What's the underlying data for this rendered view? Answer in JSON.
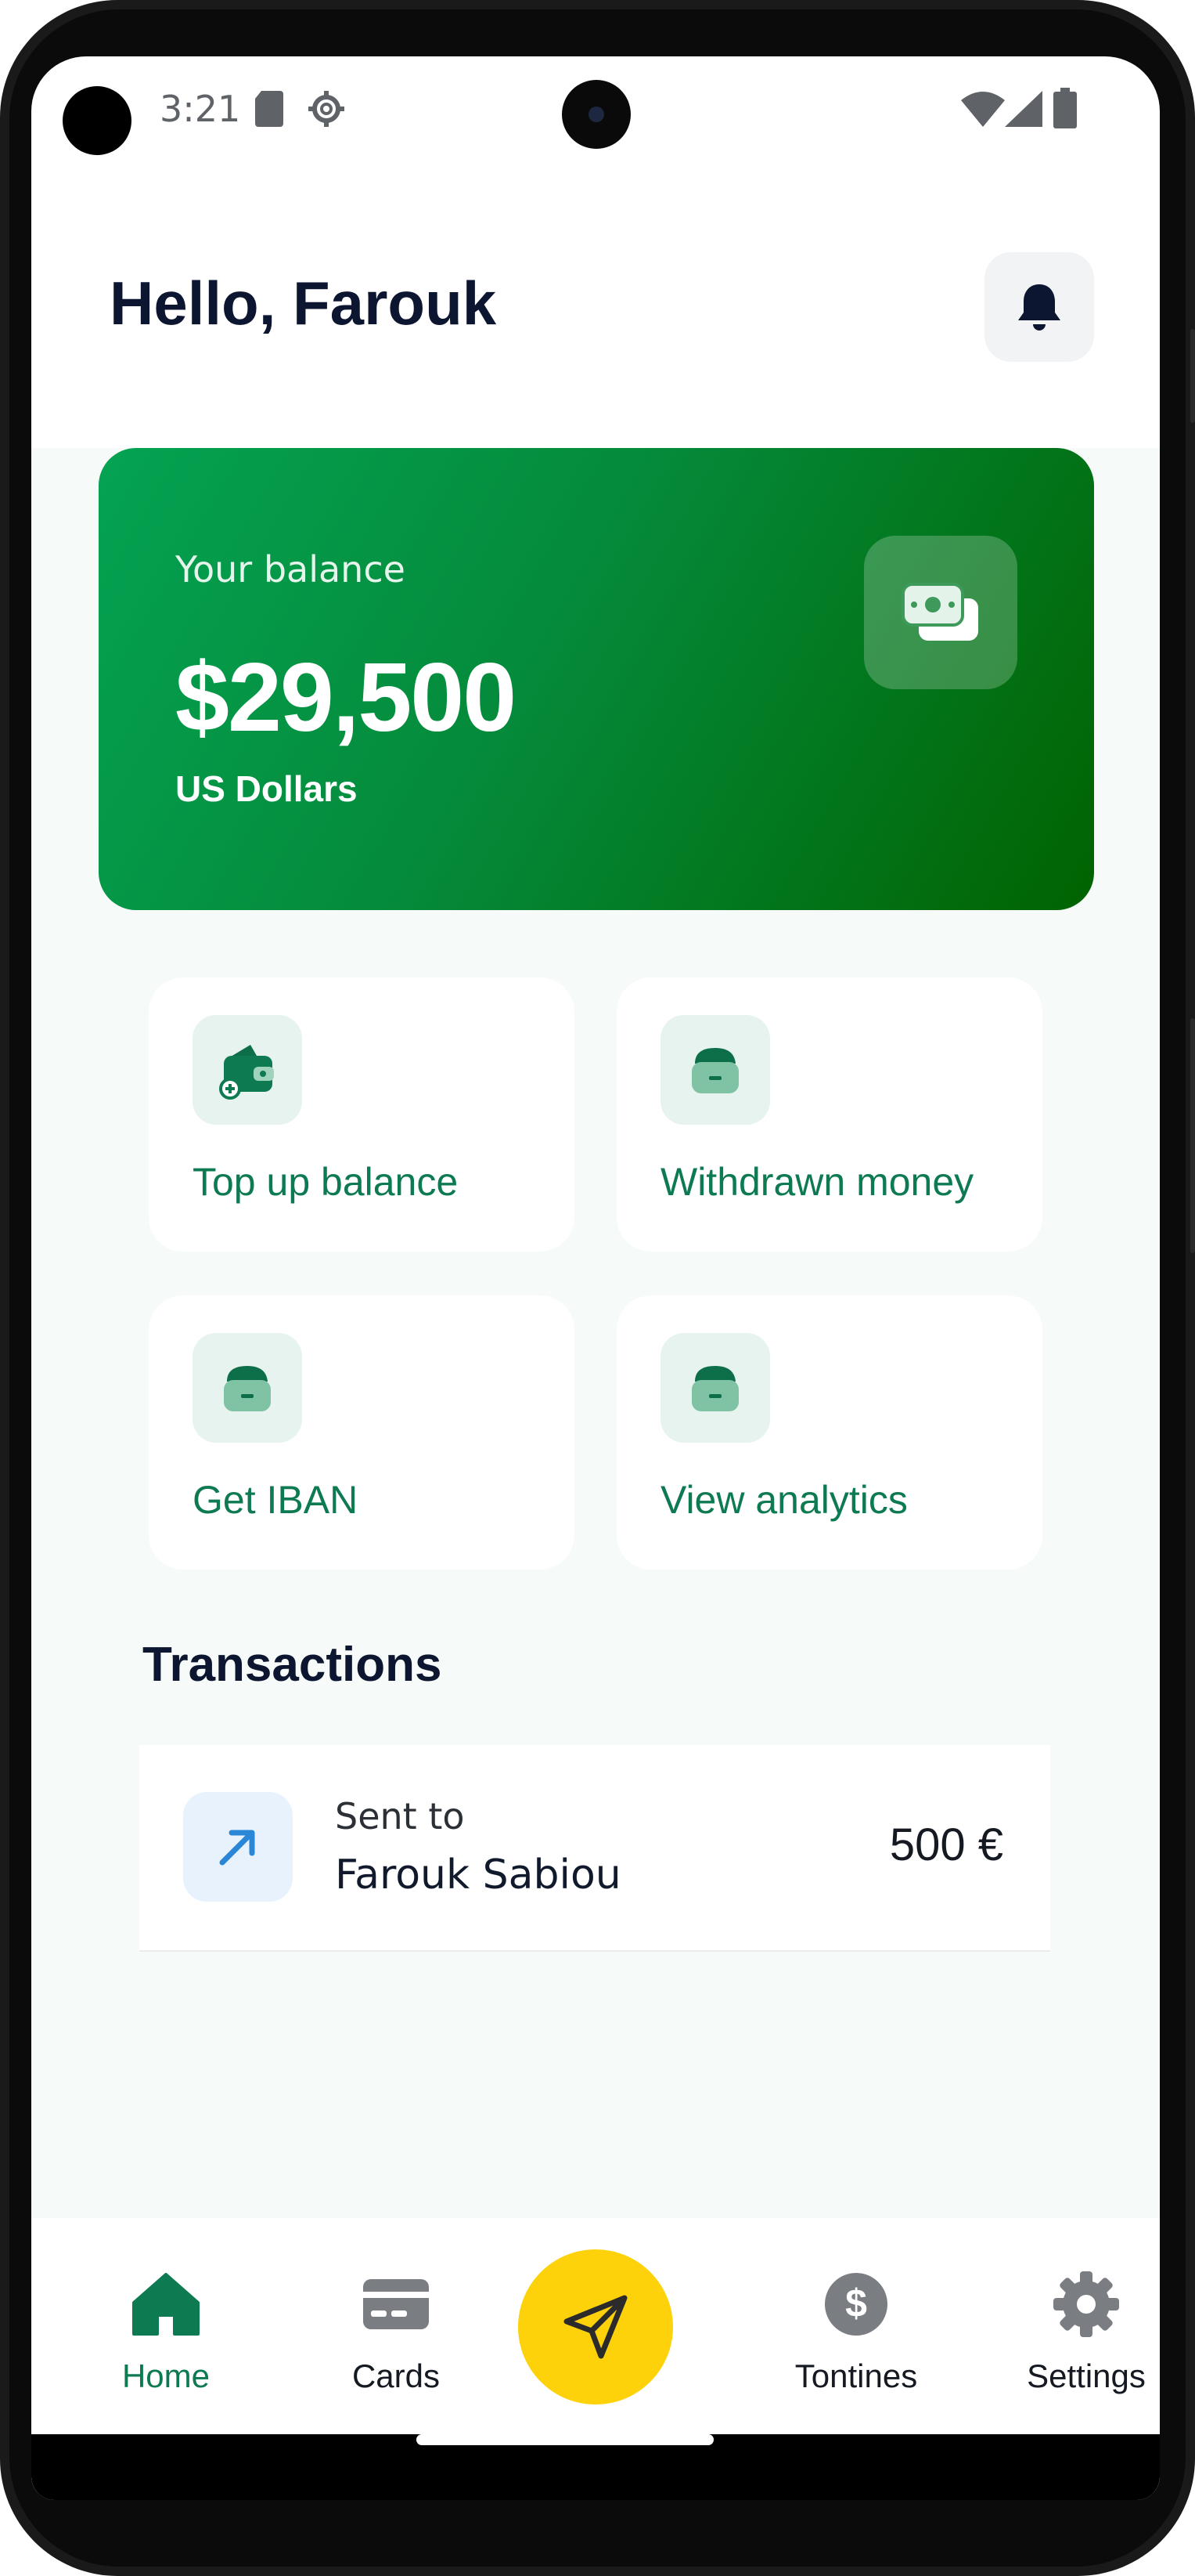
{
  "status_bar": {
    "time": "3:21"
  },
  "header": {
    "greeting": "Hello, Farouk"
  },
  "balance": {
    "label": "Your balance",
    "amount": "$29,500",
    "currency": "US Dollars"
  },
  "actions": [
    {
      "label": "Top up balance"
    },
    {
      "label": "Withdrawn money"
    },
    {
      "label": "Get IBAN"
    },
    {
      "label": "View analytics"
    }
  ],
  "transactions": {
    "title": "Transactions",
    "items": [
      {
        "caption": "Sent to",
        "name": "Farouk Sabiou",
        "amount": "500 €"
      }
    ]
  },
  "nav": {
    "items": [
      {
        "label": "Home"
      },
      {
        "label": "Cards"
      },
      {
        "label": "Tontines"
      },
      {
        "label": "Settings"
      }
    ]
  },
  "colors": {
    "brand_green": "#0d7a52",
    "card_gradient_start": "#04a352",
    "card_gradient_end": "#016300",
    "fab_yellow": "#fdd20a",
    "heading_navy": "#0d1630"
  }
}
